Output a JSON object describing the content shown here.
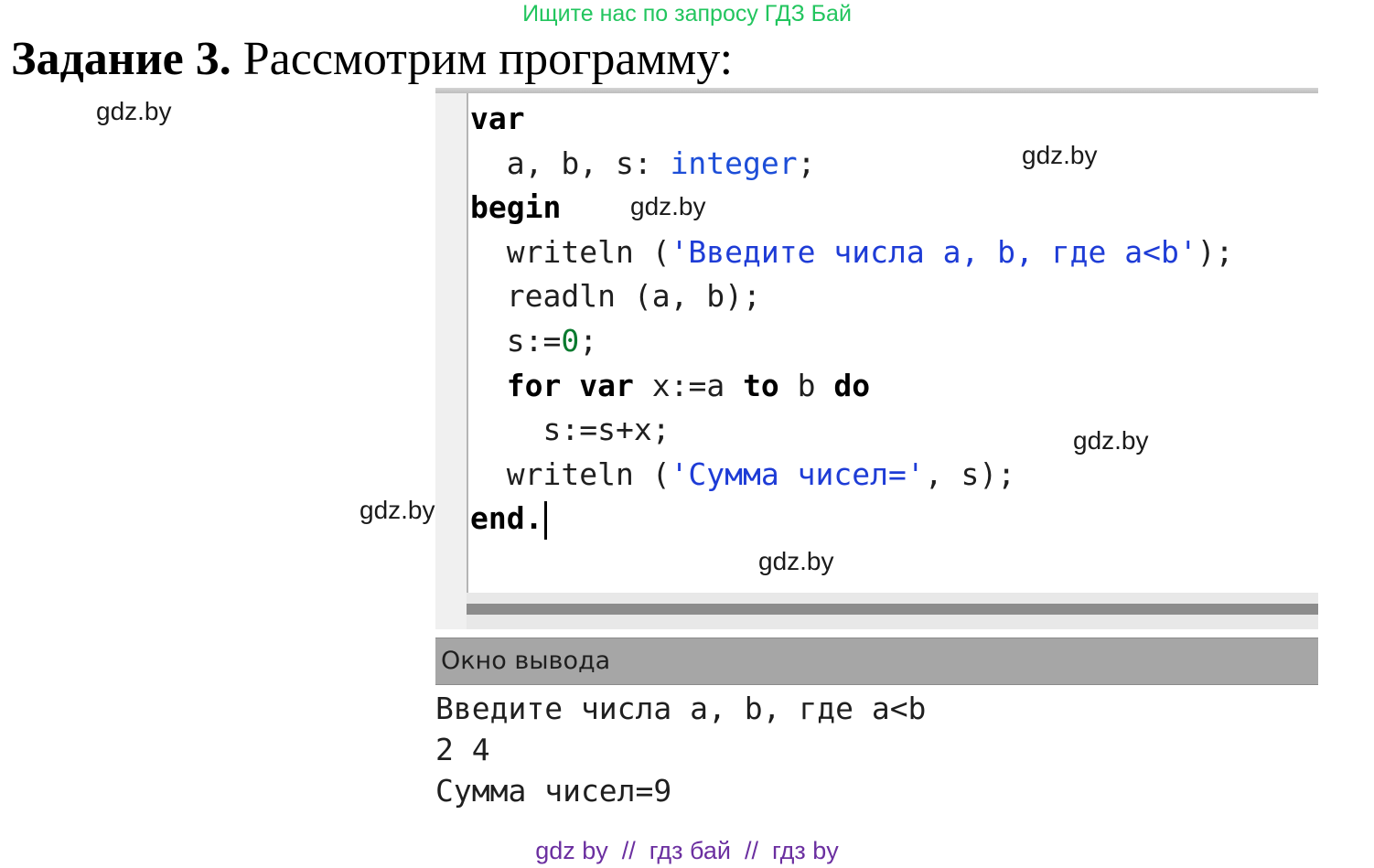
{
  "banner": {
    "text": "Ищите нас по запросу ГДЗ Бай"
  },
  "heading": {
    "label": "Задание 3.",
    "text": " Рассмотрим программу:"
  },
  "watermarks": [
    "gdz.by",
    "gdz.by",
    "gdz.by",
    "gdz.by",
    "gdz.by",
    "gdz.by"
  ],
  "code": {
    "var_kw": "var",
    "line2_vars": "a, b, s: ",
    "line2_type": "integer",
    "line2_end": ";",
    "begin_kw": "begin",
    "writeln1_call": "writeln (",
    "writeln1_str": "'Введите числа a, b, где a<b'",
    "writeln1_end": ");",
    "readln": "readln (a, b);",
    "s_assign": "s:=",
    "s_zero": "0",
    "s_semicolon": ";",
    "for_kw": "for",
    "for_var_kw": "var",
    "for_mid": " x:=a ",
    "to_kw": "to",
    "for_b": " b ",
    "do_kw": "do",
    "loop_body": "s:=s+x;",
    "writeln2_call": "writeln (",
    "writeln2_str": "'Сумма чисел='",
    "writeln2_end": ", s);",
    "end_kw": "end."
  },
  "output": {
    "title": "Окно вывода",
    "lines": [
      "Введите числа a, b, где a<b",
      "2 4",
      "Сумма чисел=9"
    ]
  },
  "footer": {
    "link1": "gdz by",
    "sep1": "  //  ",
    "link2": "гдз бай",
    "sep2": "  //  ",
    "link3": "гдз by"
  }
}
